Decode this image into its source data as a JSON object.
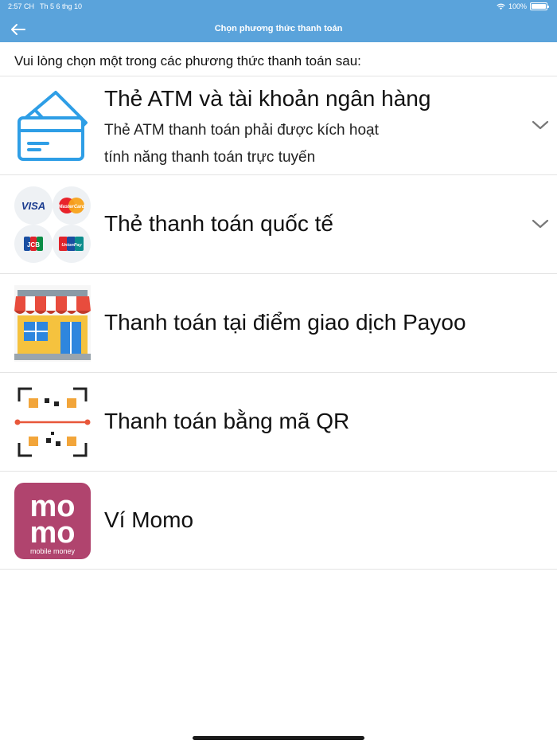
{
  "status_bar": {
    "time": "2:57 CH",
    "date": "Th 5 6 thg 10",
    "battery": "100%"
  },
  "header": {
    "title": "Chọn phương thức thanh toán",
    "back_icon": "arrow-left-icon"
  },
  "instruction": "Vui lòng chọn một trong các phương thức thanh toán sau:",
  "payment_methods": [
    {
      "title": "Thẻ ATM và tài khoản ngân hàng",
      "desc_line1": "Thẻ ATM thanh toán phải được kích hoạt",
      "desc_line2": "tính năng thanh toán trực tuyến",
      "icon": "bank-card-icon",
      "expandable": true
    },
    {
      "title": "Thẻ thanh toán quốc tế",
      "icon": "international-cards-icon",
      "card_logos": [
        "VISA",
        "MasterCard",
        "JCB",
        "UnionPay"
      ],
      "expandable": true
    },
    {
      "title": "Thanh toán tại điểm giao dịch Payoo",
      "icon": "store-icon",
      "expandable": false
    },
    {
      "title": "Thanh toán bằng mã QR",
      "icon": "qr-scan-icon",
      "expandable": false
    },
    {
      "title": "Ví Momo",
      "icon": "momo-logo-icon",
      "logo_text_1": "mo",
      "logo_text_2": "mo",
      "logo_caption": "mobile money",
      "expandable": false
    }
  ],
  "colors": {
    "header_bg": "#5aa3db",
    "card_blue": "#2e9ee6",
    "momo_pink": "#b0446e",
    "qr_orange": "#f2a53a",
    "qr_line": "#e8573a"
  }
}
